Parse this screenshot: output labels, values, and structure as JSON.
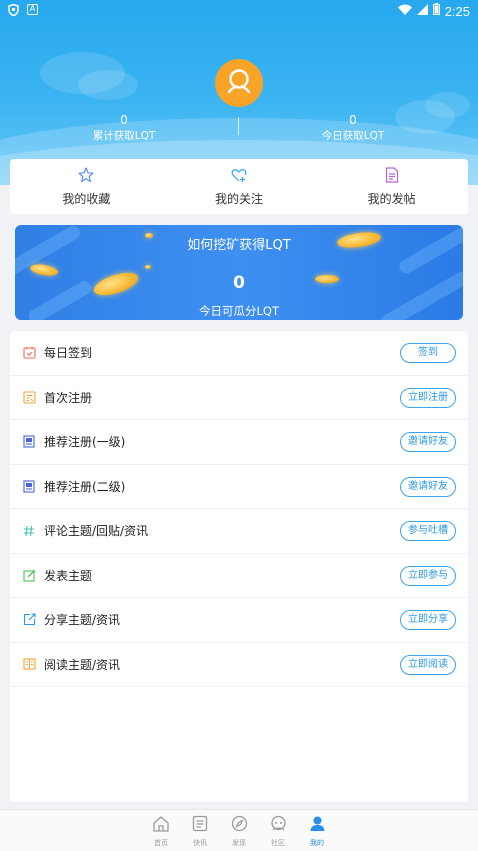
{
  "status_bar": {
    "time": "2:25"
  },
  "profile": {
    "total_lqt_value": "0",
    "total_lqt_label": "累计获取LQT",
    "today_lqt_value": "0",
    "today_lqt_label": "今日获取LQT"
  },
  "quick_actions": {
    "favorites": "我的收藏",
    "following": "我的关注",
    "posts": "我的发帖"
  },
  "banner": {
    "title": "如何挖矿获得LQT",
    "value": "0",
    "subtitle": "今日可瓜分LQT"
  },
  "tasks": [
    {
      "name": "每日签到",
      "button": "签到",
      "icon": "calendar-icon",
      "color": "#ef6a5a"
    },
    {
      "name": "首次注册",
      "button": "立即注册",
      "icon": "register-icon",
      "color": "#f2a531"
    },
    {
      "name": "推荐注册(一级)",
      "button": "邀请好友",
      "icon": "invite-icon",
      "color": "#4a63d8"
    },
    {
      "name": "推荐注册(二级)",
      "button": "邀请好友",
      "icon": "invite-icon",
      "color": "#4a63d8"
    },
    {
      "name": "评论主题/回贴/资讯",
      "button": "参与吐槽",
      "icon": "hash-icon",
      "color": "#3cc4b0"
    },
    {
      "name": "发表主题",
      "button": "立即参与",
      "icon": "edit-icon",
      "color": "#4cc25a"
    },
    {
      "name": "分享主题/资讯",
      "button": "立即分享",
      "icon": "share-icon",
      "color": "#2b98e8"
    },
    {
      "name": "阅读主题/资讯",
      "button": "立即阅读",
      "icon": "read-icon",
      "color": "#f2a531"
    }
  ],
  "bottom_nav": [
    {
      "label": "首页",
      "icon": "home-icon"
    },
    {
      "label": "快讯",
      "icon": "news-icon"
    },
    {
      "label": "发现",
      "icon": "compass-icon"
    },
    {
      "label": "社区",
      "icon": "community-icon"
    },
    {
      "label": "我的",
      "icon": "profile-icon"
    }
  ],
  "colors": {
    "header": "#2aa9ee",
    "accent": "#2b98e8",
    "avatar": "#f7a428"
  }
}
